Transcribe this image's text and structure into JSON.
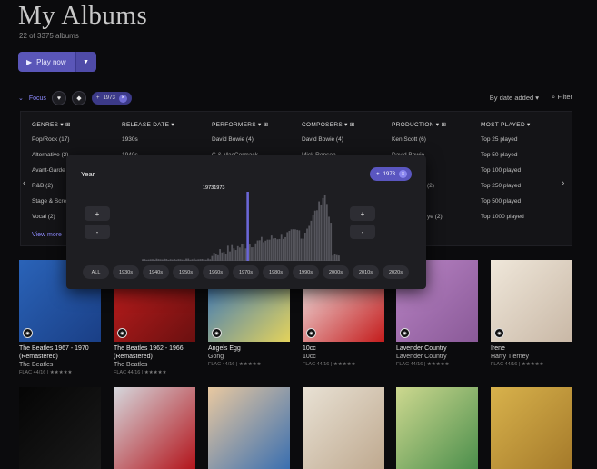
{
  "header": {
    "title": "My Albums",
    "count": "22 of 3375 albums",
    "play_label": "Play now"
  },
  "focus": {
    "label": "Focus",
    "chip_label": "1973"
  },
  "sort": {
    "label": "By date added",
    "filter_label": "Filter"
  },
  "columns": [
    {
      "header": "GENRES",
      "items": [
        "Pop/Rock (17)",
        "Alternative (2)",
        "Avant-Garde",
        "R&B (2)",
        "Stage & Scre",
        "Vocal (2)"
      ]
    },
    {
      "header": "RELEASE DATE",
      "items": [
        "1930s",
        "1940s"
      ]
    },
    {
      "header": "PERFORMERS",
      "items": [
        "David Bowie (4)",
        "C & MacCormack"
      ]
    },
    {
      "header": "COMPOSERS",
      "items": [
        "David Bowie (4)",
        "Mick Ronson"
      ]
    },
    {
      "header": "PRODUCTION",
      "items": [
        "Ken Scott (6)",
        "David Bowie",
        "",
        "(2)",
        "",
        "ye (2)"
      ]
    },
    {
      "header": "MOST PLAYED",
      "items": [
        "Top 25 played",
        "Top 50 played",
        "Top 100 played",
        "Top 250 played",
        "Top 500 played",
        "Top 1000 played"
      ]
    }
  ],
  "view_more": "View more",
  "year_overlay": {
    "title": "Year",
    "chip_label": "1973",
    "selected_label": "19731973",
    "selected_year": 1973,
    "plus": "+",
    "minus": "-",
    "decades": [
      "ALL",
      "1930s",
      "1940s",
      "1950s",
      "1960s",
      "1970s",
      "1980s",
      "1990s",
      "2000s",
      "2010s",
      "2020s"
    ]
  },
  "albums": [
    {
      "title": "The Beatles 1967 - 1970 (Remastered)",
      "artist": "The Beatles",
      "format": "FLAC 44/16 | ★★★★★",
      "colors": [
        "#2a63b8",
        "#1a3f86"
      ]
    },
    {
      "title": "The Beatles 1962 - 1966 (Remastered)",
      "artist": "The Beatles",
      "format": "FLAC 44/16 | ★★★★★",
      "colors": [
        "#c41e1e",
        "#6b1010"
      ]
    },
    {
      "title": "Angels Egg",
      "artist": "Gong",
      "format": "FLAC 44/16 | ★★★★★",
      "colors": [
        "#2b6fc4",
        "#e2d25c"
      ]
    },
    {
      "title": "10cc",
      "artist": "10cc",
      "format": "FLAC 44/16 | ★★★★★",
      "colors": [
        "#f4f4f4",
        "#c41c1c"
      ]
    },
    {
      "title": "Lavender Country",
      "artist": "Lavender Country",
      "format": "FLAC 44/16 | ★★★★★",
      "colors": [
        "#b883c4",
        "#8a5a98"
      ]
    },
    {
      "title": "Irene",
      "artist": "Harry Tierney",
      "format": "FLAC 44/16 | ★★★★★",
      "colors": [
        "#efe7da",
        "#c9b8a6"
      ]
    },
    {
      "colors": [
        "#050505",
        "#1a1a1a"
      ]
    },
    {
      "colors": [
        "#d5d7dc",
        "#b3141b"
      ]
    },
    {
      "colors": [
        "#e8c8a0",
        "#3a6fb0"
      ]
    },
    {
      "colors": [
        "#e8e1d4",
        "#bfa98f"
      ]
    },
    {
      "colors": [
        "#cdd88f",
        "#4c8f4c"
      ]
    },
    {
      "colors": [
        "#d8b24c",
        "#a57a2a"
      ]
    }
  ],
  "colors": {
    "accent": "#5a56b8",
    "link": "#8e8bff"
  }
}
